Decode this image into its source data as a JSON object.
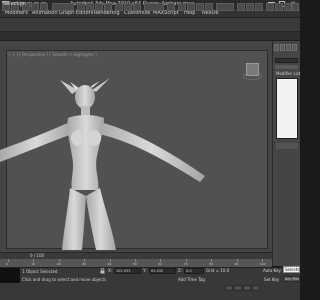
{
  "window": {
    "title": "Autodesk 3ds Max  2010 x64        Queen_Azshara.max"
  },
  "menu": [
    "Modifiers",
    "Animation",
    "Graph Editors",
    "Rendering",
    "Customize",
    "MAXScript",
    "Help",
    "NexDe"
  ],
  "ribbon": {
    "selection_label": "Selection"
  },
  "viewport": {
    "label": "[ + ] [ Perspective ] [ Smooth + Highlights ]"
  },
  "command_panel": {
    "modifier_list_label": "Modifier List"
  },
  "timeline": {
    "position": "0 / 100",
    "ticks": [
      "0",
      "10",
      "20",
      "30",
      "40",
      "50",
      "60",
      "70",
      "80",
      "90",
      "100"
    ]
  },
  "status": {
    "line1": "1 Object Selected",
    "line2": "Click and drag to select and move objects",
    "coords": {
      "x_label": "X:",
      "x_value": "101.933",
      "y_label": "Y:",
      "y_value": "61.032",
      "z_label": "Z:",
      "z_value": "0.0"
    },
    "grid": "Grid = 10.0",
    "add_time_tag": "Add Time Tag",
    "auto_key": "Auto Key",
    "auto_key_field": "Selected",
    "set_key": "Set Key",
    "key_filters": "Key Filters..."
  },
  "icons": {
    "app_logo": "3dsmax-logo-icon",
    "lock": "lock-icon",
    "viewcube": "viewcube-icon"
  },
  "colors": {
    "viewport_bg": "#515151",
    "chrome_dark": "#2a2a2a",
    "model_skin": "#d0d0d0",
    "stack_bg": "#f2f2f2"
  }
}
